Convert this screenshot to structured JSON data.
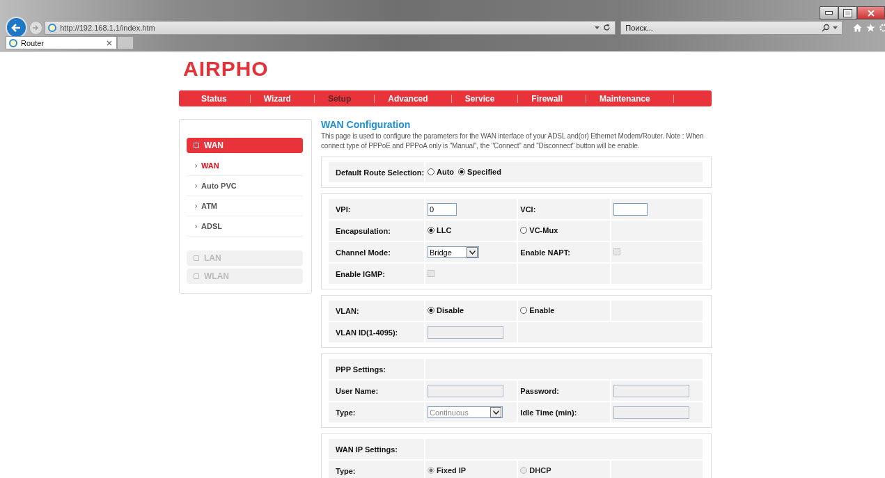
{
  "browser": {
    "url": "http://192.168.1.1/index.htm",
    "search": {
      "placeholder": "Поиск..."
    },
    "tab": {
      "title": "Router"
    }
  },
  "logo": "AIRPHO",
  "nav": [
    {
      "label": "Status",
      "selected": false
    },
    {
      "label": "Wizard",
      "selected": false
    },
    {
      "label": "Setup",
      "selected": true
    },
    {
      "label": "Advanced",
      "selected": false
    },
    {
      "label": "Service",
      "selected": false
    },
    {
      "label": "Firewall",
      "selected": false
    },
    {
      "label": "Maintenance",
      "selected": false
    }
  ],
  "sidebar": [
    {
      "label": "WAN",
      "disabled": false,
      "children": [
        {
          "label": "WAN",
          "selected": true
        },
        {
          "label": "Auto PVC",
          "selected": false
        },
        {
          "label": "ATM",
          "selected": false
        },
        {
          "label": "ADSL",
          "selected": false
        }
      ]
    },
    {
      "label": "LAN",
      "disabled": true
    },
    {
      "label": "WLAN",
      "disabled": true
    }
  ],
  "title": "WAN Configuration",
  "description": "This page is used to configure the parameters for the WAN interface of your ADSL and(or) Ethernet Modem/Router. Note : When connect type of PPPoE and PPPoA only is \"Manual\", the \"Connect\" and \"Disconnect\" button will be enable.",
  "sections": [
    {
      "rows": [
        [
          {
            "kind": "label",
            "text": "Default Route Selection:"
          },
          {
            "kind": "radios",
            "options": [
              {
                "label": "Auto",
                "selected": false,
                "disabled": false
              },
              {
                "label": "Specified",
                "selected": true,
                "disabled": false
              }
            ]
          }
        ]
      ]
    },
    {
      "rows": [
        [
          {
            "kind": "label",
            "text": "VPI:"
          },
          {
            "kind": "input",
            "value": "0",
            "disabled": false
          },
          {
            "kind": "label",
            "text": "VCI:"
          },
          {
            "kind": "input",
            "disabled": false
          }
        ],
        [
          {
            "kind": "label",
            "text": "Encapsulation:"
          },
          {
            "kind": "radios",
            "options": [
              {
                "label": "LLC",
                "selected": true,
                "disabled": false
              }
            ]
          },
          {
            "kind": "radios",
            "options": [
              {
                "label": "VC-Mux",
                "selected": false,
                "disabled": false
              }
            ]
          },
          {
            "kind": "empty"
          }
        ],
        [
          {
            "kind": "label",
            "text": "Channel Mode:"
          },
          {
            "kind": "select",
            "value": "Bridge",
            "disabled": false
          },
          {
            "kind": "label",
            "text": "Enable NAPT:"
          },
          {
            "kind": "checkbox",
            "checked": false,
            "disabled": true
          }
        ],
        [
          {
            "kind": "label",
            "text": "Enable IGMP:"
          },
          {
            "kind": "checkbox",
            "checked": false,
            "disabled": true
          },
          {
            "kind": "empty"
          },
          {
            "kind": "empty"
          }
        ]
      ]
    },
    {
      "rows": [
        [
          {
            "kind": "label",
            "text": "VLAN:"
          },
          {
            "kind": "radios",
            "options": [
              {
                "label": "Disable",
                "selected": true,
                "disabled": false
              }
            ]
          },
          {
            "kind": "radios",
            "options": [
              {
                "label": "Enable",
                "selected": false,
                "disabled": false
              }
            ]
          },
          {
            "kind": "empty"
          }
        ],
        [
          {
            "kind": "label",
            "text": "VLAN ID(1-4095):"
          },
          {
            "kind": "input",
            "disabled": true
          },
          {
            "kind": "empty"
          }
        ]
      ]
    },
    {
      "rows": [
        [
          {
            "kind": "label",
            "text": "PPP Settings:"
          },
          {
            "kind": "empty"
          }
        ],
        [
          {
            "kind": "label",
            "text": "User Name:"
          },
          {
            "kind": "input",
            "disabled": true
          },
          {
            "kind": "label",
            "text": "Password:"
          },
          {
            "kind": "input",
            "disabled": true
          }
        ],
        [
          {
            "kind": "label",
            "text": "Type:"
          },
          {
            "kind": "select",
            "value": "Continuous",
            "disabled": true
          },
          {
            "kind": "label",
            "text": "Idle Time (min):"
          },
          {
            "kind": "input",
            "disabled": true
          }
        ]
      ]
    },
    {
      "rows": [
        [
          {
            "kind": "label",
            "text": "WAN IP Settings:"
          },
          {
            "kind": "empty"
          }
        ],
        [
          {
            "kind": "label",
            "text": "Type:"
          },
          {
            "kind": "radios",
            "options": [
              {
                "label": "Fixed IP",
                "selected": true,
                "disabled": true
              }
            ]
          },
          {
            "kind": "radios",
            "options": [
              {
                "label": "DHCP",
                "selected": false,
                "disabled": true
              }
            ]
          },
          {
            "kind": "empty"
          }
        ]
      ]
    }
  ]
}
